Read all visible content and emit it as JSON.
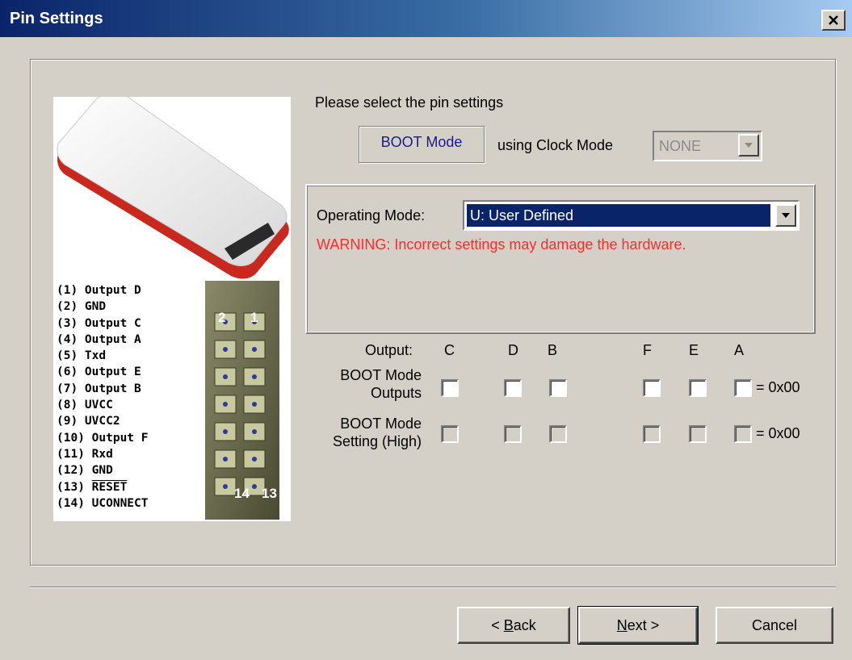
{
  "window": {
    "title": "Pin Settings"
  },
  "device": {
    "pins": [
      "(1) Output D",
      "(2) GND",
      "(3) Output C",
      "(4) Output A",
      "(5) Txd",
      "(6) Output E",
      "(7) Output B",
      "(8) UVCC",
      "(9) UVCC2",
      "(10) Output F",
      "(11) Rxd",
      "(12) GND"
    ],
    "pin_13_prefix": "(13) ",
    "pin_13_name": "RESET",
    "pin_14": "(14) UCONNECT",
    "connector_labels": {
      "top_left": "2",
      "top_right": "1",
      "bottom_left": "14",
      "bottom_right": "13"
    }
  },
  "prompt": "Please select the pin settings",
  "boot_mode": {
    "label": "BOOT Mode",
    "clock_label": "using Clock Mode",
    "clock_value": "NONE"
  },
  "operating_mode": {
    "label": "Operating Mode:",
    "value": "U: User Defined",
    "warning": "WARNING: Incorrect settings may damage the hardware.",
    "warning_color": "#ff2a2a"
  },
  "outputs": {
    "header_label": "Output:",
    "columns": [
      "C",
      "D",
      "B",
      "F",
      "E",
      "A"
    ],
    "rows": [
      {
        "label_line1": "BOOT Mode",
        "label_line2": "Outputs",
        "hex": "= 0x00",
        "enabled": true
      },
      {
        "label_line1": "BOOT Mode",
        "label_line2": "Setting (High)",
        "hex": "= 0x00",
        "enabled": false
      }
    ]
  },
  "buttons": {
    "back_prefix": "< ",
    "back_mnemonic": "B",
    "back_rest": "ack",
    "next_mnemonic": "N",
    "next_rest": "ext >",
    "cancel": "Cancel"
  },
  "icons": {
    "close": "close-x-icon",
    "dropdown": "dropdown-arrow-icon"
  }
}
